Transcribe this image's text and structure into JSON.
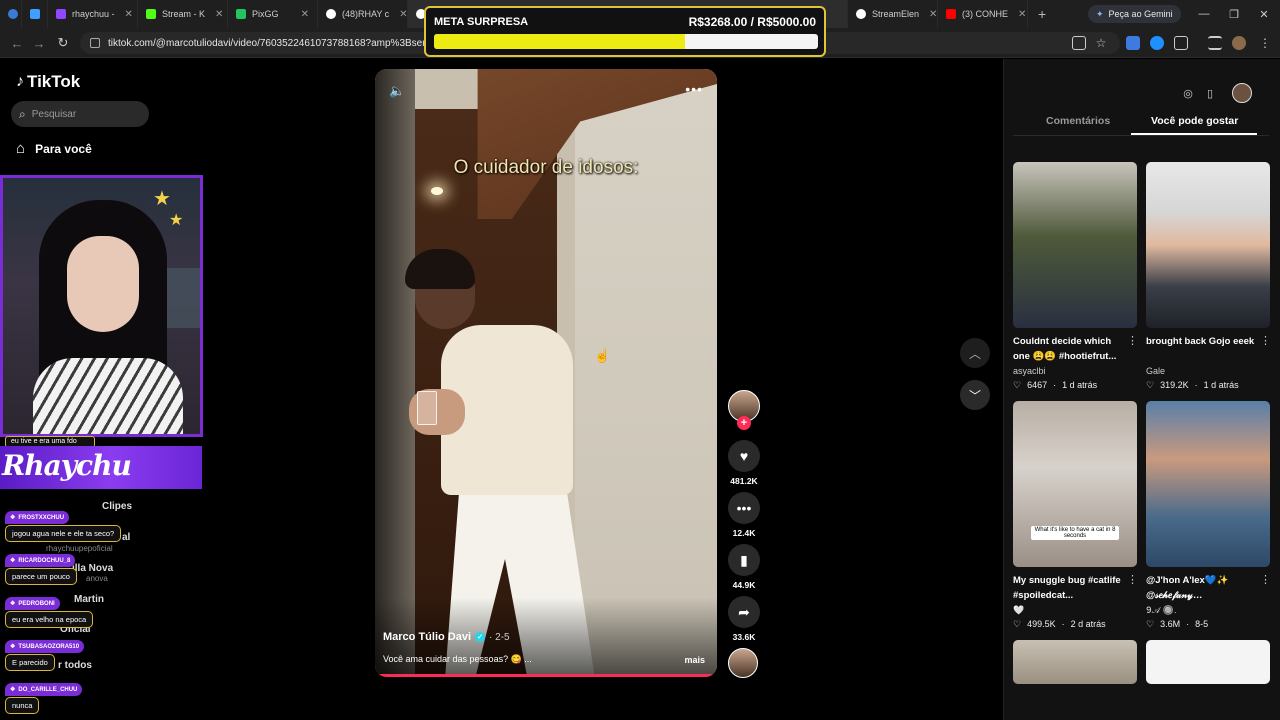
{
  "browser": {
    "tabs": [
      {
        "title": "rhaychuu -",
        "color": "#9147ff"
      },
      {
        "title": "Stream - K",
        "color": "#53fc18"
      },
      {
        "title": "PixGG",
        "color": "#22c55e"
      },
      {
        "title": "(48)RHAY c",
        "color": "#ffffff"
      },
      {
        "title": "StreamElen",
        "color": "#ffffff"
      },
      {
        "title": "(3) CONHE",
        "color": "#ff0000"
      }
    ],
    "gemini_label": "Peça ao Gemini",
    "url": "tiktok.com/@marcotuliodavi/video/7603522461073788168?amp%3Bsender_d"
  },
  "goal": {
    "title": "META SURPRESA",
    "amount": "R$3268.00 / R$5000.00",
    "progress_fraction": 0.6536
  },
  "tiktok": {
    "logo": "TikTok",
    "search_placeholder": "Pesquisar",
    "nav_foryou": "Para você",
    "sidebar_fragments": [
      "Clipes",
      "al",
      "illa Nova",
      "Martin",
      "Oficial",
      "r todos"
    ],
    "sidebar_subs": [
      "rhaychuupepoficial",
      "anova"
    ]
  },
  "stream_overlay": {
    "chat_cut_text": "eu tive e era uma fdo",
    "banner_title": "Rhaychu",
    "messages": [
      {
        "user": "FROSTXXCHUU",
        "text": "jogou agua nele e ele ta seco?"
      },
      {
        "user": "RICARDOCHUU_8",
        "text": "parece um pouco"
      },
      {
        "user": "PEDROBONI",
        "text": "eu era velho na epoca"
      },
      {
        "user": "TSUBASAOZORA510",
        "text": "E parecido"
      },
      {
        "user": "DO_CARILLE_CHUU",
        "text": "nunca"
      }
    ]
  },
  "video": {
    "caption_overlay": "O cuidador de idosos:",
    "author": "Marco Túlio Davi",
    "date": "2-5",
    "description": "Você ama cuidar das pessoas? 😋 ...",
    "more_label": "mais",
    "likes": "481.2K",
    "comments": "12.4K",
    "saves": "44.9K",
    "shares": "33.6K"
  },
  "right_panel": {
    "tab_comments": "Comentários",
    "tab_suggested": "Você pode gostar",
    "cards": [
      {
        "title": "Couldnt decide which one 😩😩 #hootiefrut...",
        "author": "asyaclbi",
        "likes": "6467",
        "age": "1 d atrás",
        "bg": "#4e5a3a"
      },
      {
        "title": "brought back Gojo eeek",
        "author": "Gale",
        "likes": "319.2K",
        "age": "1 d atrás",
        "bg": "#3a3f48"
      },
      {
        "title": "My snuggle bug #catlife #spoiledcat...",
        "author": "🤍",
        "likes": "499.5K",
        "age": "2 d atrás",
        "bg": "#9a8f86",
        "thumb_caption": "What it's like to have a cat in 8 seconds"
      },
      {
        "title": "@J'hon A'lex💙✨ @𝓈𝑒𝒽𝑒𝒻𝒶𝓃𝓎…",
        "author": "𝟫𝒜 🔘.",
        "likes": "3.6M",
        "age": "8-5",
        "bg": "#4a6a8a"
      }
    ]
  }
}
